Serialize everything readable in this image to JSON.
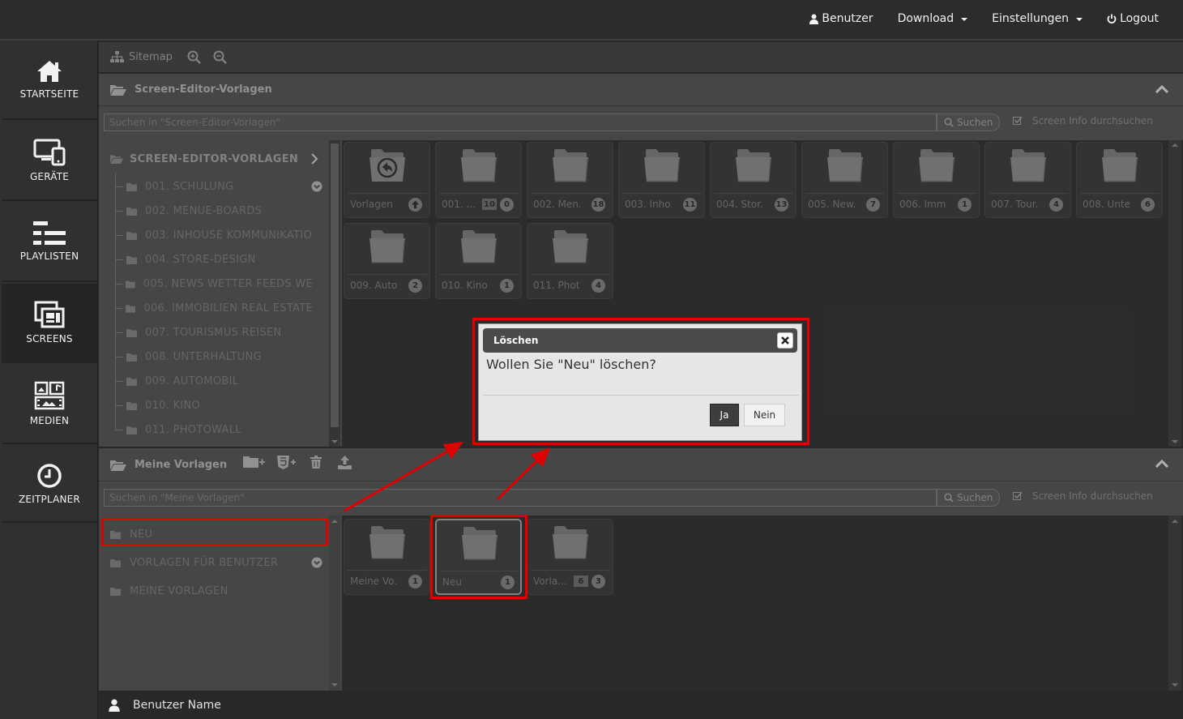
{
  "topnav": {
    "benutzer": "Benutzer",
    "download": "Download",
    "einstellungen": "Einstellungen",
    "logout": "Logout"
  },
  "sidebar": {
    "items": [
      {
        "label": "STARTSEITE",
        "icon": "home-icon"
      },
      {
        "label": "GERÄTE",
        "icon": "devices-icon"
      },
      {
        "label": "PLAYLISTEN",
        "icon": "playlist-icon"
      },
      {
        "label": "SCREENS",
        "icon": "screens-icon",
        "active": true
      },
      {
        "label": "MEDIEN",
        "icon": "media-icon"
      },
      {
        "label": "ZEITPLANER",
        "icon": "clock-icon"
      }
    ]
  },
  "toolbar": {
    "sitemap": "Sitemap"
  },
  "panel1": {
    "title": "Screen-Editor-Vorlagen",
    "search_placeholder": "Suchen in \"Screen-Editor-Vorlagen\"",
    "search_button": "Suchen",
    "search_info": "Screen Info durchsuchen",
    "tree_root": "SCREEN-EDITOR-VORLAGEN",
    "tree_items": [
      "001. SCHULUNG",
      "002. MENUE-BOARDS",
      "003. INHOUSE KOMMUNIKATIO",
      "004. STORE-DESIGN",
      "005. NEWS WETTER FEEDS WE",
      "006. IMMOBILIEN REAL ESTATE",
      "007. TOURISMUS REISEN",
      "008. UNTERHALTUNG",
      "009. AUTOMOBIL",
      "010. KINO",
      "011. PHOTOWALL"
    ],
    "tiles": [
      {
        "label": "Vorlagen",
        "back": true
      },
      {
        "label": "001. ...",
        "folders": "10",
        "count": "0"
      },
      {
        "label": "002. Men...",
        "count": "18"
      },
      {
        "label": "003. Inho...",
        "count": "11"
      },
      {
        "label": "004. Stor...",
        "count": "13"
      },
      {
        "label": "005. New...",
        "count": "7"
      },
      {
        "label": "006. Imm...",
        "count": "1"
      },
      {
        "label": "007. Tour...",
        "count": "4"
      },
      {
        "label": "008. Unte...",
        "count": "6"
      },
      {
        "label": "009. Auto...",
        "count": "2"
      },
      {
        "label": "010. Kino",
        "count": "1"
      },
      {
        "label": "011. Phot...",
        "count": "4"
      }
    ]
  },
  "panel2": {
    "title": "Meine Vorlagen",
    "search_placeholder": "Suchen in \"Meine Vorlagen\"",
    "search_button": "Suchen",
    "search_info": "Screen Info durchsuchen",
    "tree_items": [
      "NEU",
      "VORLAGEN FÜR BENUTZER",
      "MEINE VORLAGEN"
    ],
    "tiles": [
      {
        "label": "Meine Vo...",
        "count": "1"
      },
      {
        "label": "Neu",
        "count": "1"
      },
      {
        "label": "Vorla...",
        "folders": "6",
        "count": "3"
      }
    ]
  },
  "dialog": {
    "title": "Löschen",
    "message": "Wollen Sie \"Neu\" löschen?",
    "yes": "Ja",
    "no": "Nein"
  },
  "footer": {
    "user": "Benutzer Name"
  },
  "colors": {
    "highlight": "#e00000"
  }
}
